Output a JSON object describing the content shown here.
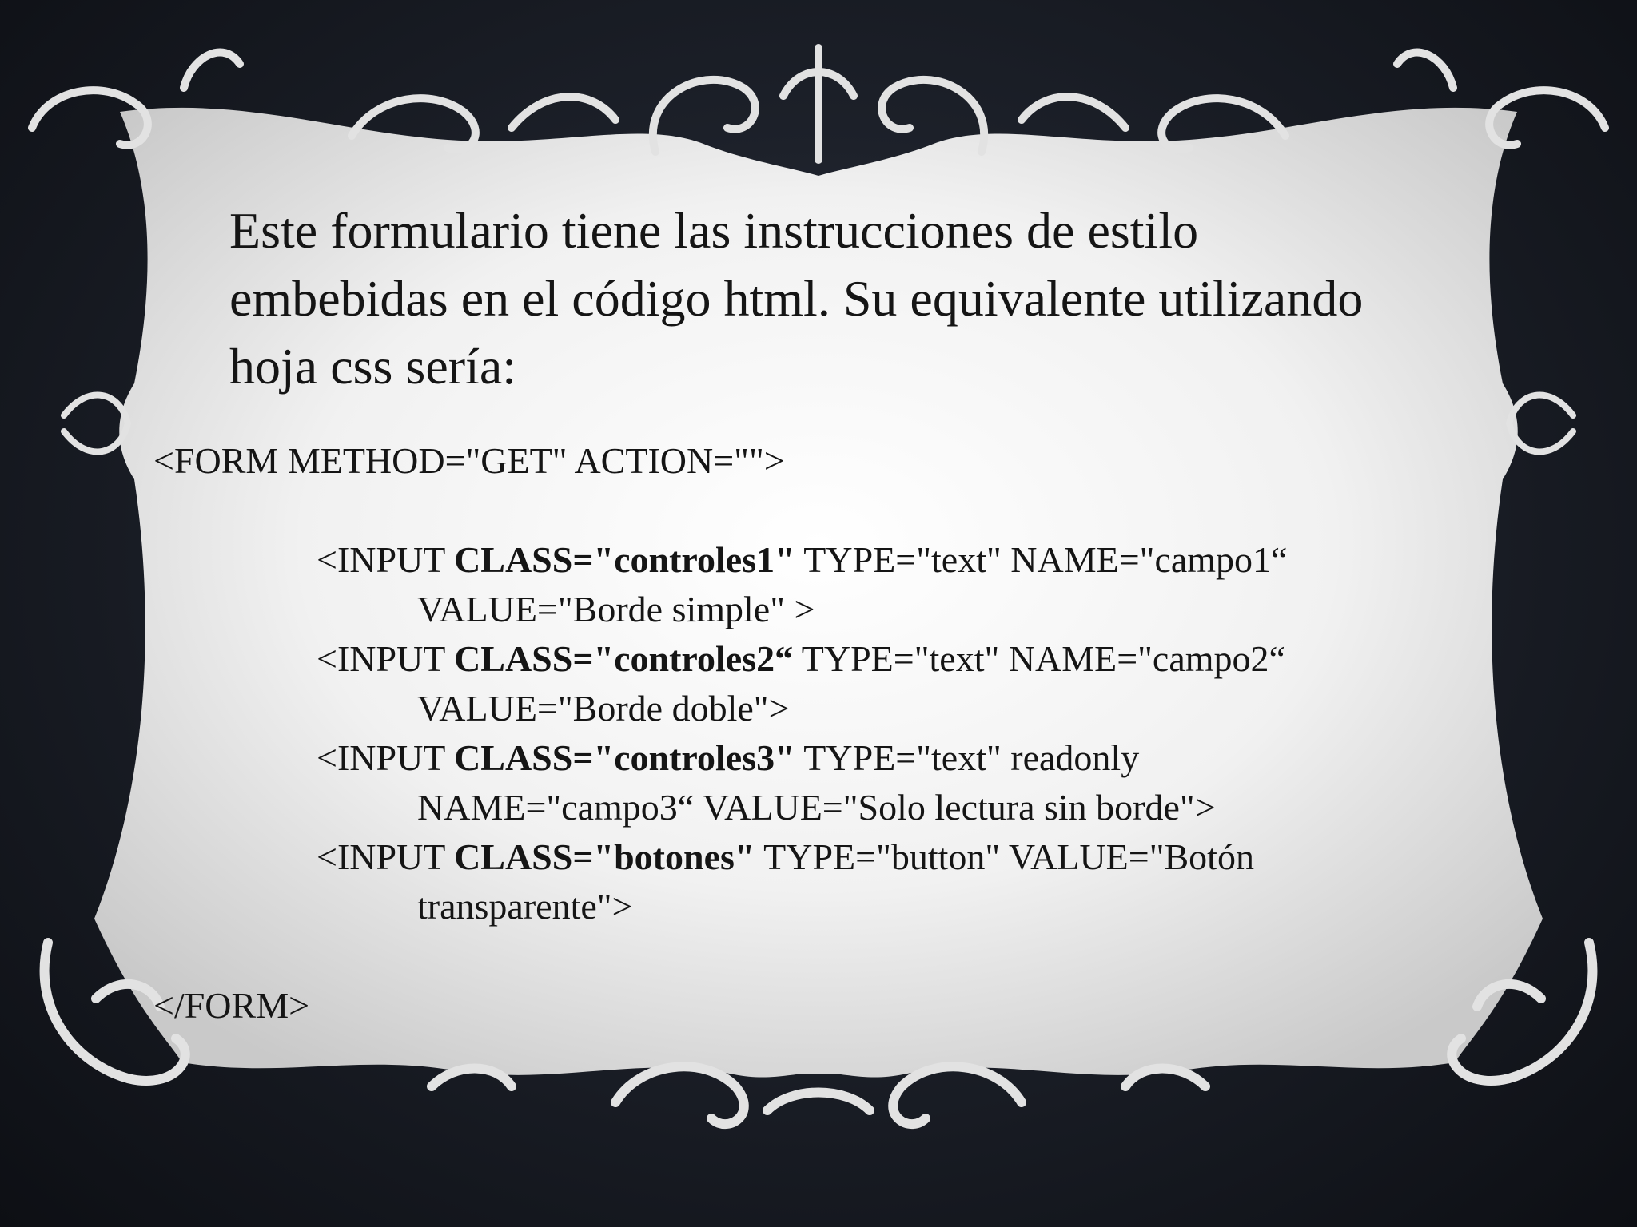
{
  "slide": {
    "intro_text": "Este formulario tiene las instrucciones de estilo embebidas en el código html. Su equivalente utilizando hoja css sería:",
    "form_open": "<FORM METHOD=\"GET\" ACTION=\"\">",
    "inputs": [
      {
        "prefix": "<INPUT ",
        "class_attr": "CLASS=\"controles1\"",
        "rest": " TYPE=\"text\" NAME=\"campo1“",
        "continuation": "VALUE=\"Borde simple\" >"
      },
      {
        "prefix": "<INPUT ",
        "class_attr": "CLASS=\"controles2“",
        "rest": " TYPE=\"text\" NAME=\"campo2“",
        "continuation": "VALUE=\"Borde doble\">"
      },
      {
        "prefix": "<INPUT ",
        "class_attr": "CLASS=\"controles3\"",
        "rest": " TYPE=\"text\" readonly",
        "continuation": "NAME=\"campo3“ VALUE=\"Solo lectura sin borde\">"
      },
      {
        "prefix": "<INPUT ",
        "class_attr": "CLASS=\"botones\"",
        "rest": " TYPE=\"button\" VALUE=\"Botón",
        "continuation": "transparente\">"
      }
    ],
    "form_close": "</FORM>"
  },
  "colors": {
    "background": "#1c2029",
    "frame_fill": "#f4f4f4",
    "ornament": "#e6e6e6",
    "text": "#151515"
  }
}
